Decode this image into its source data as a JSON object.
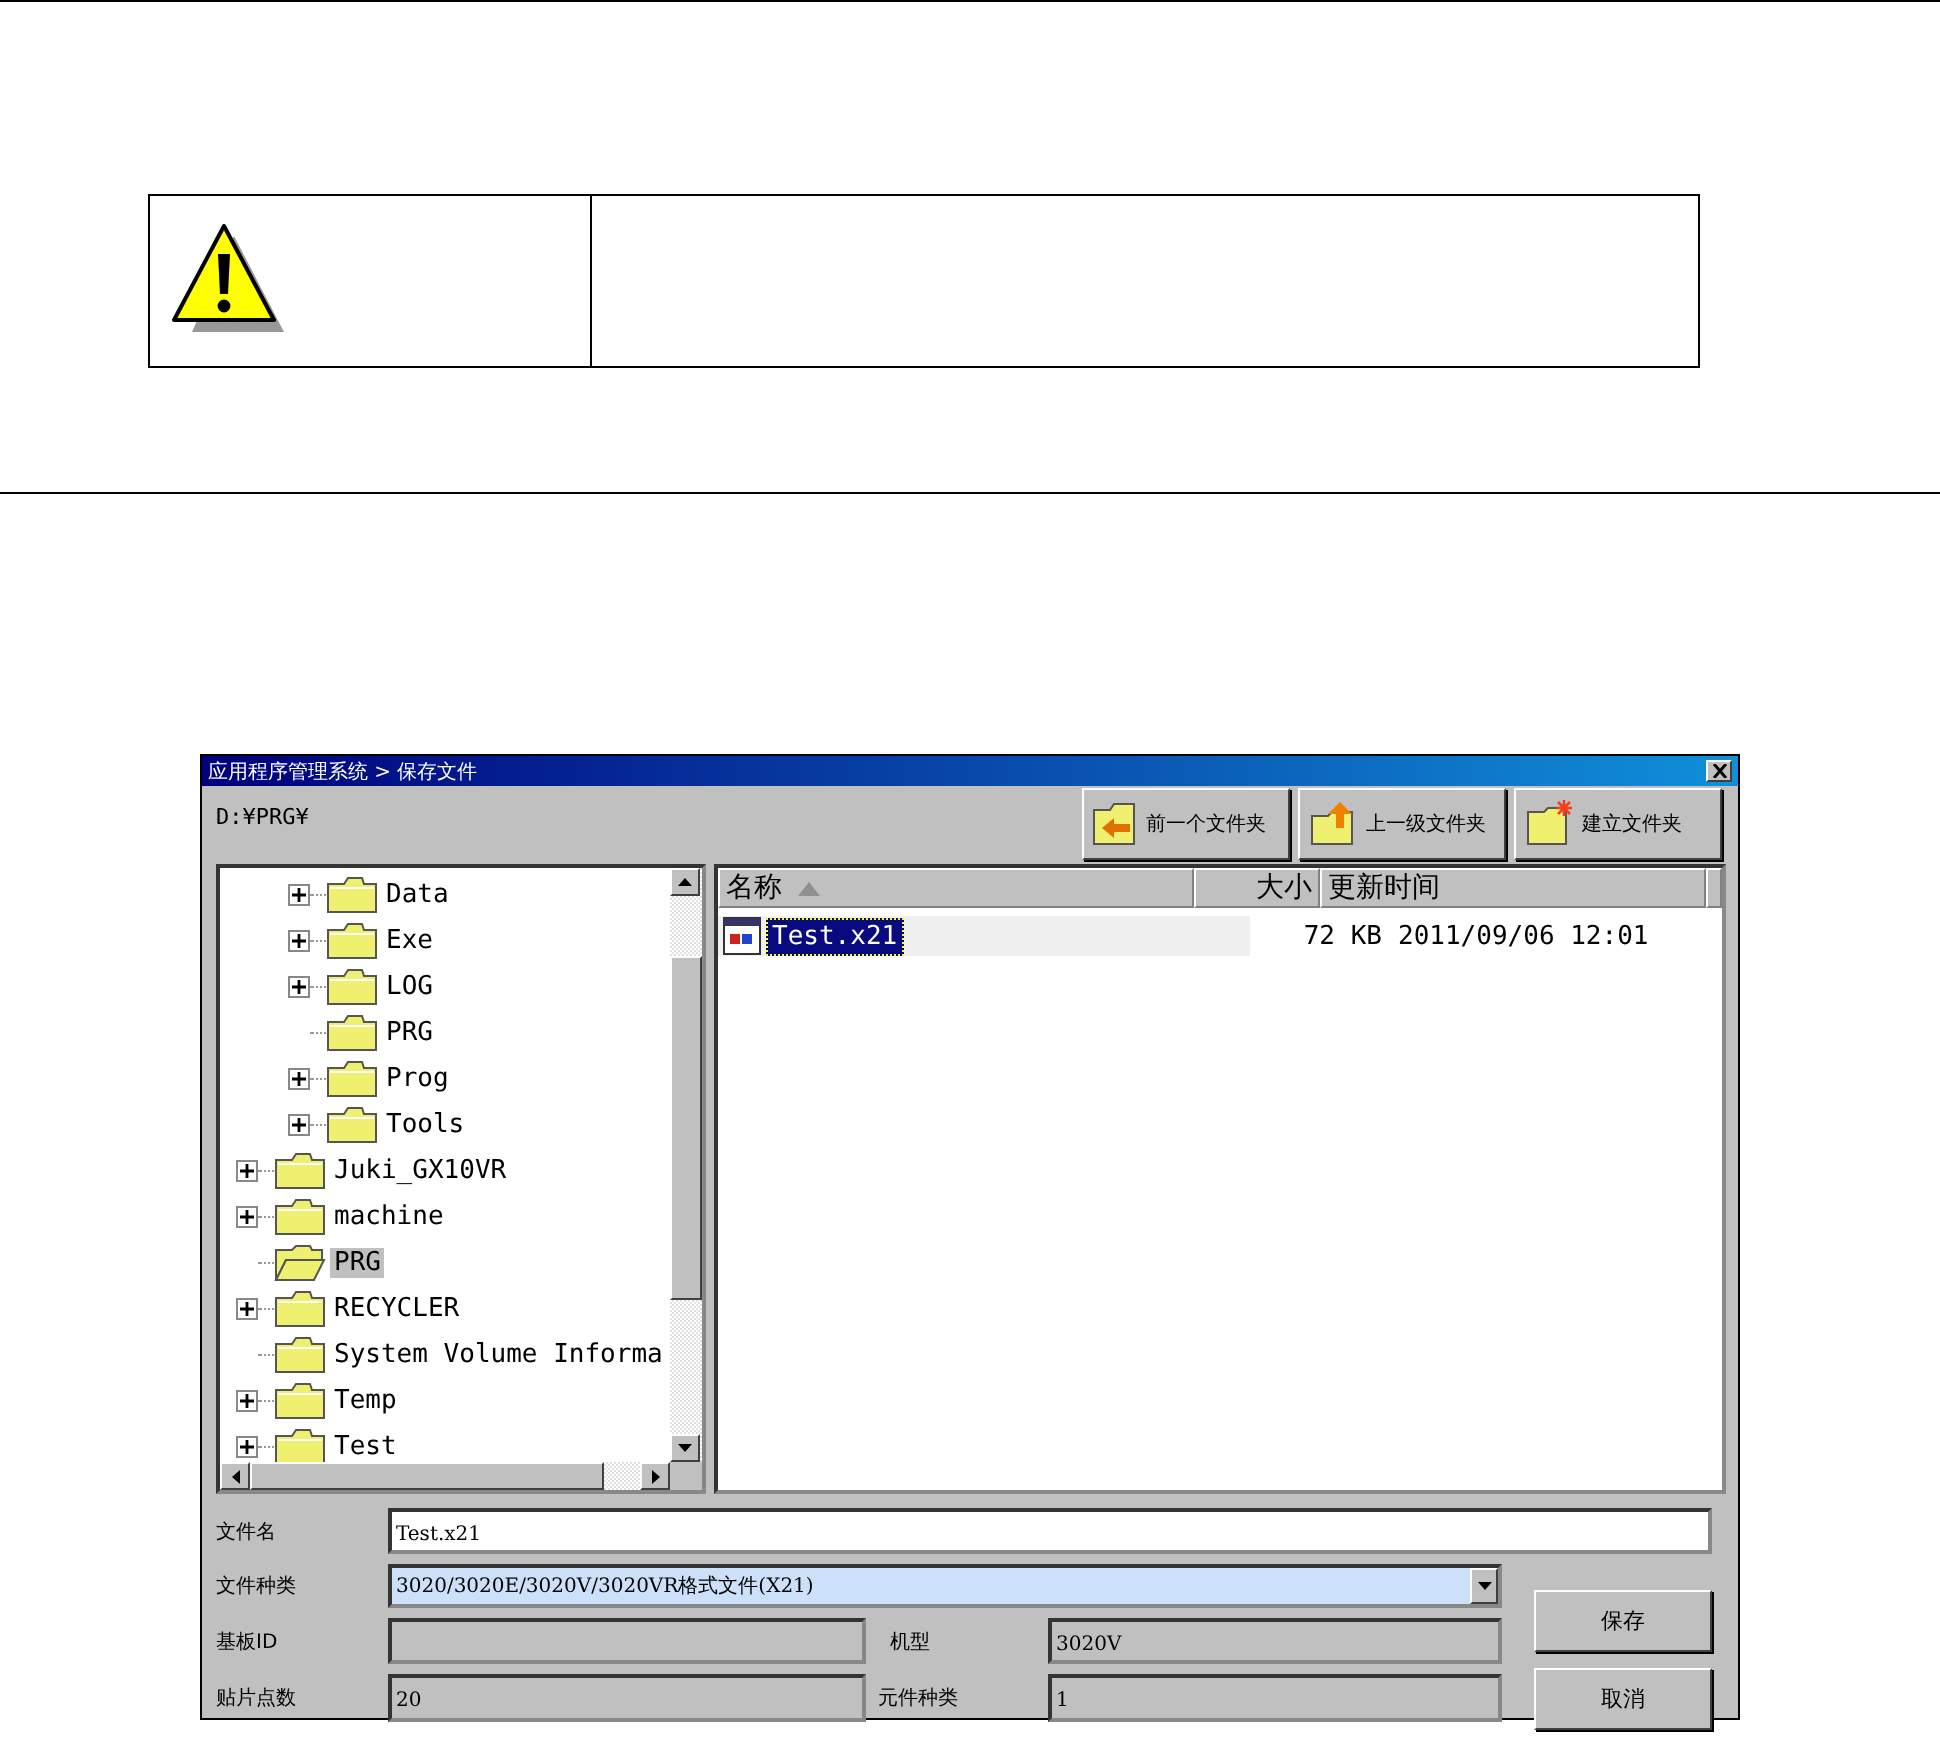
{
  "dialog": {
    "title": "应用程序管理系统 > 保存文件",
    "path": "D:¥PRG¥",
    "nav_buttons": [
      {
        "label": "前一个文件夹",
        "kind": "back"
      },
      {
        "label": "上一级文件夹",
        "kind": "up"
      },
      {
        "label": "建立文件夹",
        "kind": "new"
      }
    ],
    "tree": {
      "items": [
        {
          "children": [
            {
              "label": "Data",
              "expandable": true,
              "selected": false
            },
            {
              "label": "Exe",
              "expandable": true,
              "selected": false
            },
            {
              "label": "LOG",
              "expandable": true,
              "selected": false
            },
            {
              "label": "PRG",
              "expandable": false,
              "selected": false
            },
            {
              "label": "Prog",
              "expandable": true,
              "selected": false
            },
            {
              "label": "Tools",
              "expandable": true,
              "selected": false
            }
          ]
        },
        {
          "label": "Juki_GX10VR",
          "expandable": true,
          "selected": false
        },
        {
          "label": "machine",
          "expandable": true,
          "selected": false
        },
        {
          "label": "PRG",
          "expandable": false,
          "selected": true
        },
        {
          "label": "RECYCLER",
          "expandable": true,
          "selected": false
        },
        {
          "label": "System Volume Informa",
          "expandable": false,
          "selected": false
        },
        {
          "label": "Temp",
          "expandable": true,
          "selected": false
        },
        {
          "label": "Test",
          "expandable": true,
          "selected": false
        }
      ]
    },
    "file_list": {
      "columns": [
        "名称",
        "大小",
        "更新时间"
      ],
      "rows": [
        {
          "name": "Test.x21",
          "size": "72 KB",
          "updated": "2011/09/06 12:01",
          "selected": true
        }
      ]
    },
    "form": {
      "file_name_label": "文件名",
      "file_name": "Test.x21",
      "file_type_label": "文件种类",
      "file_type": "3020/3020E/3020V/3020VR格式文件(X21)",
      "board_id_label": "基板ID",
      "model_label": "机型",
      "model": "3020V",
      "points_label": "贴片点数",
      "points": "20",
      "parts_label": "元件种类",
      "parts": "1"
    },
    "buttons": [
      "保存",
      "取消"
    ]
  }
}
